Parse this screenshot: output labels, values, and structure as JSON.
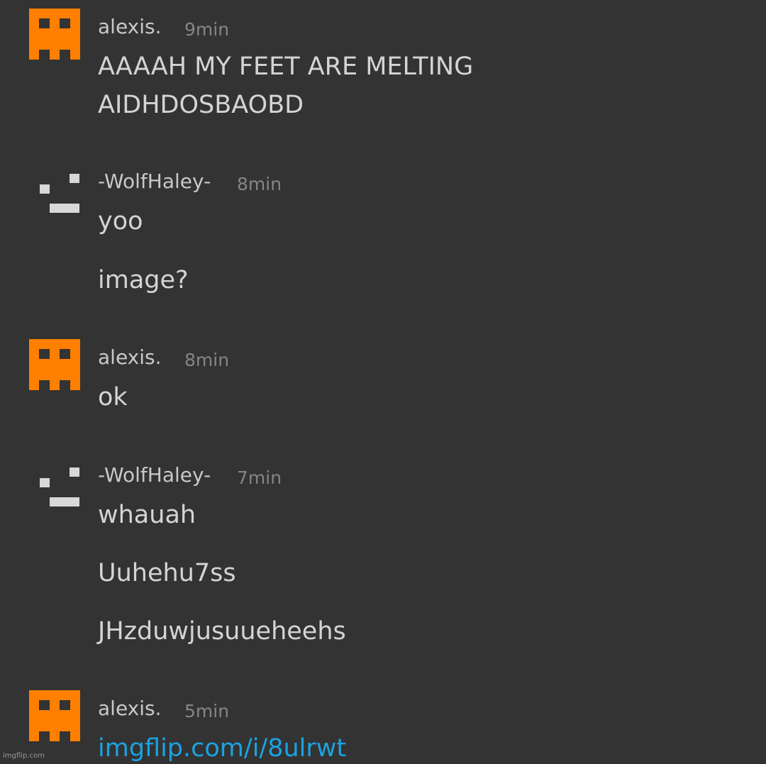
{
  "colors": {
    "background": "#333333",
    "username": "#c8c8c8",
    "timestamp": "#858585",
    "message_text": "#d4d4d4",
    "link": "#1aa3e0",
    "creeper_avatar": "#ff7f00",
    "wolf_avatar": "#d8d8d8"
  },
  "messages": [
    {
      "avatar_icon": "creeper-face-icon",
      "username": "alexis.",
      "time": "9min",
      "lines": [
        "AAAAH MY FEET ARE MELTING",
        "AIDHDOSBAOBD"
      ]
    },
    {
      "avatar_icon": "wink-face-icon",
      "username": "-WolfHaley-",
      "time": "8min",
      "lines": [
        "yoo",
        "image?"
      ]
    },
    {
      "avatar_icon": "creeper-face-icon",
      "username": "alexis.",
      "time": "8min",
      "lines": [
        "ok"
      ]
    },
    {
      "avatar_icon": "wink-face-icon",
      "username": "-WolfHaley-",
      "time": "7min",
      "lines": [
        "whauah",
        "Uuhehu7ss",
        "JHzduwjusuueheehs"
      ]
    },
    {
      "avatar_icon": "creeper-face-icon",
      "username": "alexis.",
      "time": "5min",
      "link": "imgflip.com/i/8ulrwt"
    }
  ],
  "watermark": "imgflip.com"
}
